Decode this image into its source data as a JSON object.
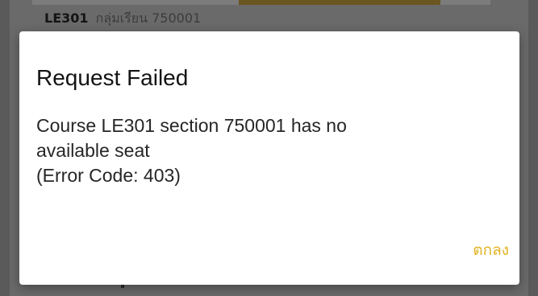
{
  "background": {
    "course_code": "LE301",
    "course_section_label": "กลุ่มเรียน 750001"
  },
  "dialog": {
    "title": "Request Failed",
    "message_lines": [
      "Course LE301 section 750001 has no",
      "available seat",
      "(Error Code: 403)"
    ],
    "confirm_label": "ตกลง"
  },
  "colors": {
    "scrim": "#5f5f5f",
    "dialog_background": "#ffffff",
    "title_text": "#141414",
    "message_text": "#262626",
    "accent_button": "#e2b324"
  }
}
